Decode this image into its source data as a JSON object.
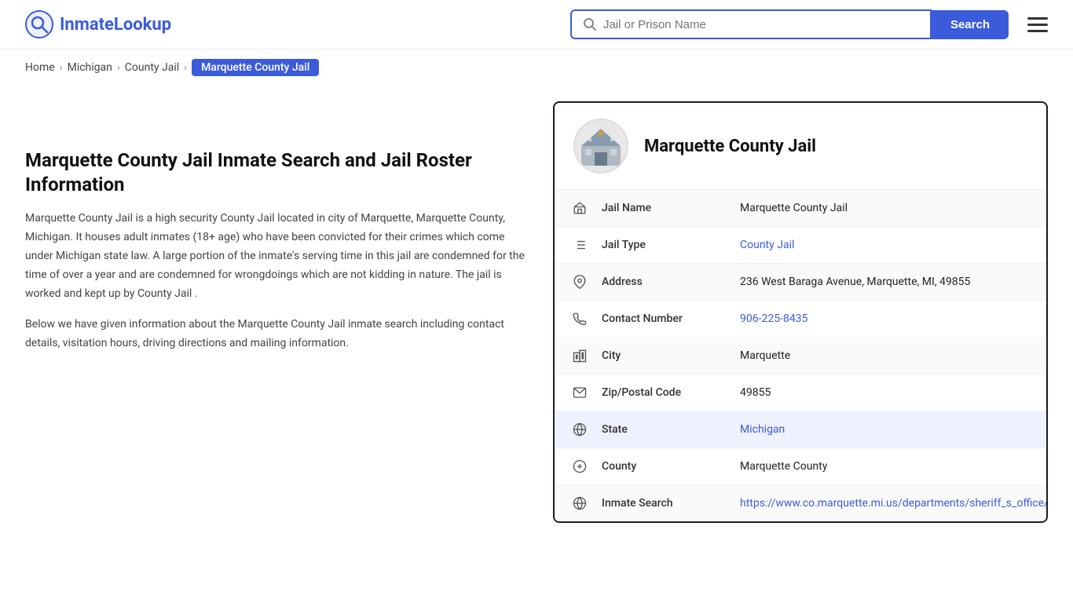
{
  "header": {
    "logo_text_part1": "Inmate",
    "logo_text_part2": "Lookup",
    "search_placeholder": "Jail or Prison Name",
    "search_button_label": "Search",
    "menu_icon": "hamburger-icon"
  },
  "breadcrumb": {
    "home": "Home",
    "state": "Michigan",
    "type": "County Jail",
    "current": "Marquette County Jail"
  },
  "left": {
    "title": "Marquette County Jail Inmate Search and Jail Roster Information",
    "paragraph1": "Marquette County Jail is a high security County Jail located in city of Marquette, Marquette County, Michigan. It houses adult inmates (18+ age) who have been convicted for their crimes which come under Michigan state law. A large portion of the inmate's serving time in this jail are condemned for the time of over a year and are condemned for wrongdoings which are not kidding in nature. The jail is worked and kept up by County Jail .",
    "paragraph2": "Below we have given information about the Marquette County Jail inmate search including contact details, visitation hours, driving directions and mailing information."
  },
  "card": {
    "jail_name_heading": "Marquette County Jail",
    "rows": [
      {
        "icon": "jail-icon",
        "label": "Jail Name",
        "value": "Marquette County Jail",
        "link": false
      },
      {
        "icon": "list-icon",
        "label": "Jail Type",
        "value": "County Jail",
        "link": true,
        "href": "#"
      },
      {
        "icon": "pin-icon",
        "label": "Address",
        "value": "236 West Baraga Avenue, Marquette, MI, 49855",
        "link": false
      },
      {
        "icon": "phone-icon",
        "label": "Contact Number",
        "value": "906-225-8435",
        "link": true,
        "href": "tel:906-225-8435"
      },
      {
        "icon": "city-icon",
        "label": "City",
        "value": "Marquette",
        "link": false
      },
      {
        "icon": "mail-icon",
        "label": "Zip/Postal Code",
        "value": "49855",
        "link": false
      },
      {
        "icon": "globe-icon",
        "label": "State",
        "value": "Michigan",
        "link": true,
        "href": "#",
        "highlight": true
      },
      {
        "icon": "county-icon",
        "label": "County",
        "value": "Marquette County",
        "link": false
      },
      {
        "icon": "search-globe-icon",
        "label": "Inmate Search",
        "value": "https://www.co.marquette.mi.us/departments/sheriff_s_office/ja",
        "link": true,
        "href": "https://www.co.marquette.mi.us/departments/sheriff_s_office/ja"
      }
    ]
  }
}
